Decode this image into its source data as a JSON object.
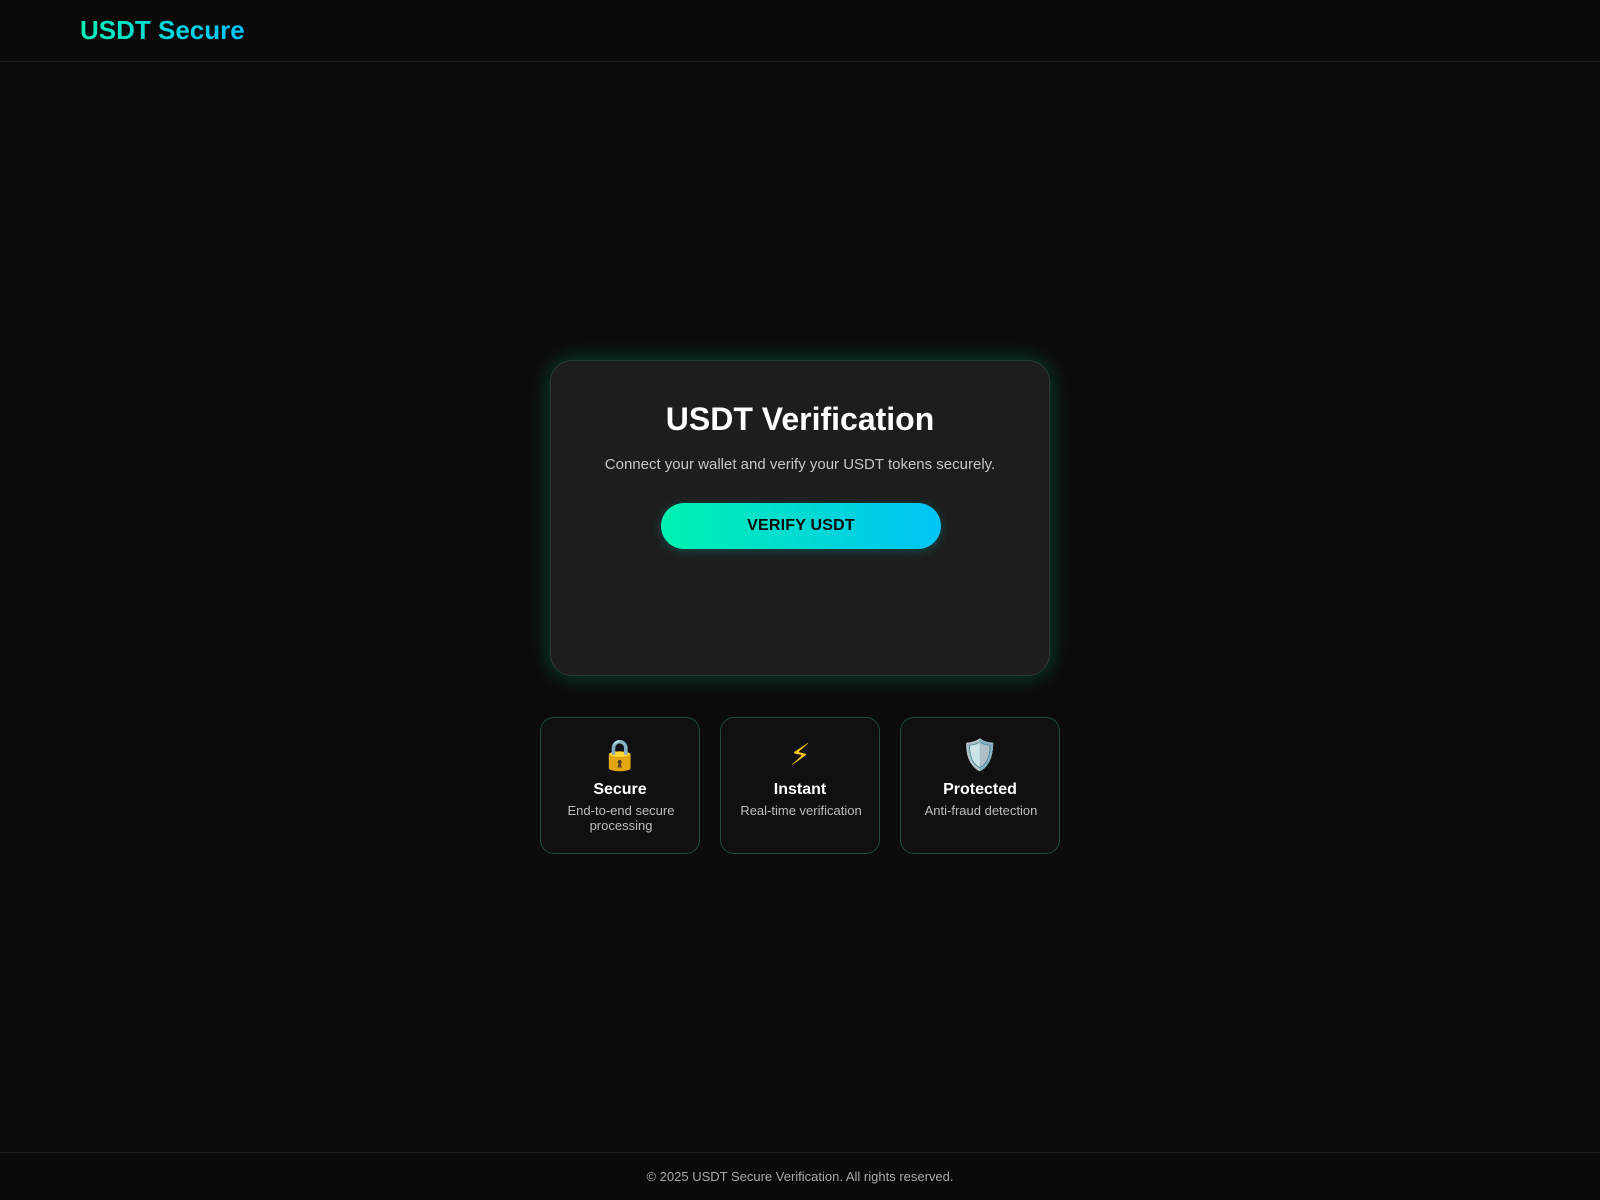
{
  "header": {
    "logo": "USDT Secure"
  },
  "card": {
    "title": "USDT Verification",
    "subtitle": "Connect your wallet and verify your USDT tokens securely.",
    "button_label": "VERIFY USDT"
  },
  "features": [
    {
      "icon": "lock-icon",
      "glyph": "🔒",
      "title": "Secure",
      "description": "End-to-end secure processing"
    },
    {
      "icon": "lightning-icon",
      "glyph": "⚡",
      "title": "Instant",
      "description": "Real-time verification"
    },
    {
      "icon": "shield-icon",
      "glyph": "🛡️",
      "title": "Protected",
      "description": "Anti-fraud detection"
    }
  ],
  "footer": {
    "text": "© 2025 USDT Secure Verification. All rights reserved."
  },
  "colors": {
    "background": "#0b0b0b",
    "card": "#1d1d1d",
    "accent_start": "#00f2b0",
    "accent_end": "#00c3f5",
    "feature_border": "#1e4a3c"
  }
}
